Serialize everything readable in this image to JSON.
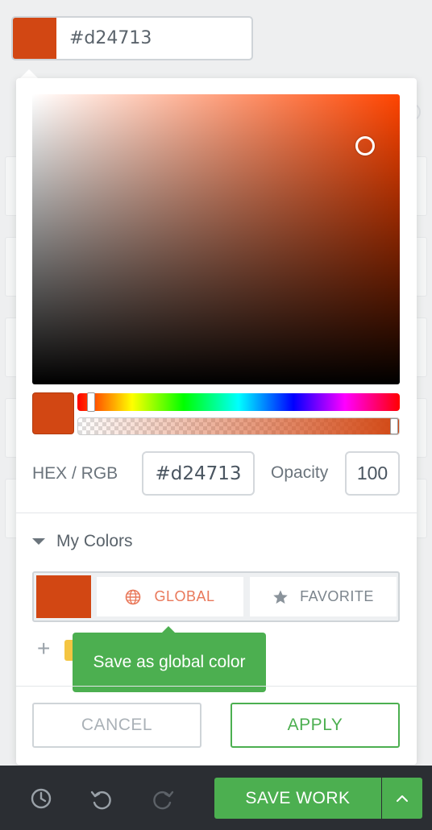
{
  "color_field": {
    "swatch_color": "#d24713",
    "value": "#d24713"
  },
  "picker": {
    "hue_color": "#ff4a00",
    "current_color": "#d24713",
    "hex_label": "HEX / RGB",
    "hex_value": "#d24713",
    "opacity_label": "Opacity",
    "opacity_value": "100"
  },
  "my_colors": {
    "heading": "My Colors",
    "saved_color": "#d24713",
    "global_label": "GLOBAL",
    "favorite_label": "FAVORITE",
    "add_label": "+",
    "tooltip": "Save as global color"
  },
  "actions": {
    "cancel_label": "CANCEL",
    "apply_label": "APPLY"
  },
  "toolbar": {
    "save_label": "SAVE WORK",
    "icons": [
      "history-icon",
      "undo-icon",
      "redo-icon",
      "chevron-up-icon"
    ]
  },
  "colors": {
    "accent_green": "#4caf50",
    "global_accent": "#e9785a"
  }
}
